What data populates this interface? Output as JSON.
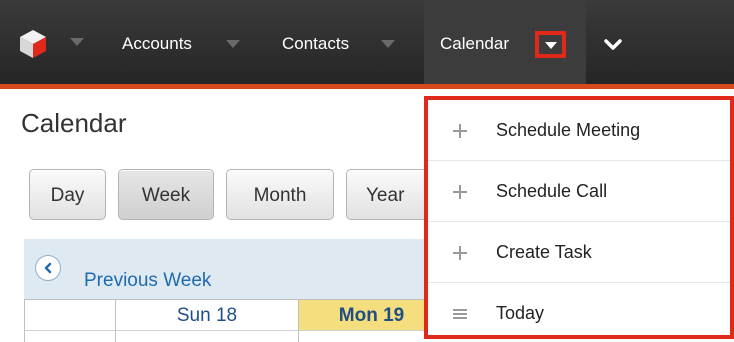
{
  "navbar": {
    "logo_icon": "sugarcrm-cube-icon",
    "items": [
      {
        "label": "Accounts"
      },
      {
        "label": "Contacts"
      },
      {
        "label": "Calendar"
      }
    ],
    "active_item": "Calendar",
    "accent_color": "#d84a1b",
    "highlight_color": "#e0281b"
  },
  "page": {
    "title": "Calendar"
  },
  "views": [
    "Day",
    "Week",
    "Month",
    "Year"
  ],
  "active_view": "Week",
  "calendar": {
    "prev_link": "Previous Week",
    "days": [
      {
        "label": "Sun 18"
      },
      {
        "label": "Mon 19"
      }
    ],
    "today_color": "#f4de7e"
  },
  "menu": {
    "items": [
      {
        "label": "Schedule Meeting",
        "icon": "plus-icon"
      },
      {
        "label": "Schedule Call",
        "icon": "plus-icon"
      },
      {
        "label": "Create Task",
        "icon": "plus-icon"
      },
      {
        "label": "Today",
        "icon": "list-icon"
      }
    ]
  }
}
